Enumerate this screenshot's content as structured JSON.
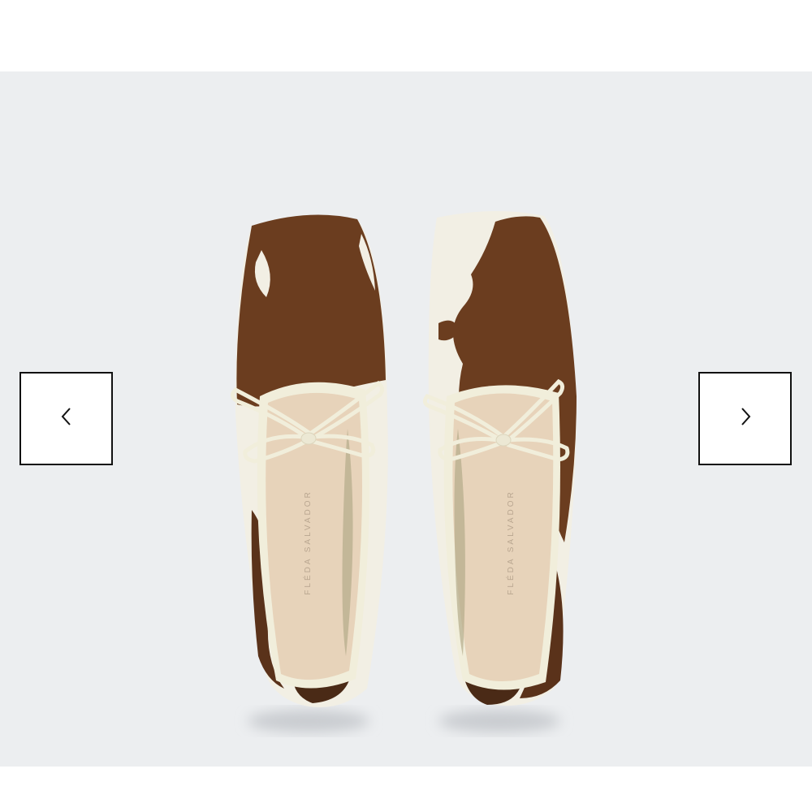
{
  "carousel": {
    "prev_icon": "chevron-left-icon",
    "next_icon": "chevron-right-icon",
    "image": {
      "subject": "pair of cow-print calf hair ballet flats with cream leather bow and trim",
      "insole_brand": "FLÉDA SALVADOR"
    }
  },
  "colors": {
    "page_background": "#ffffff",
    "stage_background": "#eceef0",
    "button_border": "#111111",
    "hide_brown": "#6b3d1f",
    "hide_cream": "#f2efe4",
    "trim_cream": "#f1eedb",
    "insole": "#e7d3ba"
  }
}
